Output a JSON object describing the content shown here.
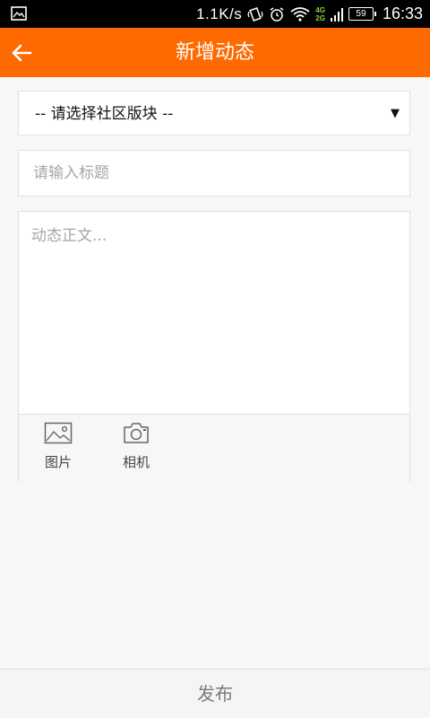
{
  "status_bar": {
    "speed": "1.1K/s",
    "net_top": "4G",
    "net_bottom": "2G",
    "battery": "59",
    "time": "16:33",
    "icons": [
      "image-icon",
      "vibrate-icon",
      "alarm-icon",
      "wifi-icon",
      "signal-icon",
      "battery-icon"
    ]
  },
  "header": {
    "title": "新增动态",
    "back_icon": "arrow-left-icon",
    "bg_color": "#ff6a00"
  },
  "form": {
    "section_select": {
      "value": "-- 请选择社区版块 --",
      "arrow": "▼"
    },
    "title_input": {
      "placeholder": "请输入标题",
      "value": ""
    },
    "body_input": {
      "placeholder": "动态正文...",
      "value": ""
    },
    "attachments": [
      {
        "label": "图片",
        "icon": "picture-icon"
      },
      {
        "label": "相机",
        "icon": "camera-icon"
      }
    ]
  },
  "footer": {
    "submit_label": "发布"
  }
}
